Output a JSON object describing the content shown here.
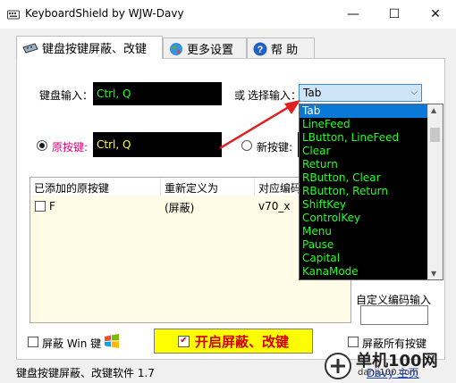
{
  "window": {
    "title": "KeyboardShield by WJW-Davy",
    "minimize_glyph": "—",
    "maximize_glyph": "☐",
    "close_glyph": "✕"
  },
  "tabs": [
    {
      "label": "键盘按键屏蔽、改键",
      "icon": "keyboard-icon",
      "active": true
    },
    {
      "label": "更多设置",
      "icon": "globe-icon",
      "active": false
    },
    {
      "label": "帮 助",
      "icon": "help-icon",
      "active": false
    }
  ],
  "keyboard_input": {
    "label": "键盘输入：",
    "value": "Ctrl, Q"
  },
  "select_input": {
    "or_label": "或",
    "label": "选择输入：",
    "value": "Tab"
  },
  "dropdown": {
    "options": [
      "Tab",
      "LineFeed",
      "LButton, LineFeed",
      "Clear",
      "Return",
      "RButton, Clear",
      "RButton, Return",
      "ShiftKey",
      "ControlKey",
      "Menu",
      "Pause",
      "Capital",
      "KanaMode"
    ],
    "selected": "Tab"
  },
  "original_key": {
    "label": "原按键:",
    "value": "Ctrl, Q",
    "checked": true
  },
  "new_key": {
    "label": "新按键:",
    "checked": false
  },
  "list": {
    "columns": [
      "已添加的原按键",
      "重新定义为",
      "对应编码"
    ],
    "rows": [
      {
        "key": "F",
        "redefine": "(屏蔽)",
        "code": "v70_x",
        "checked": false
      }
    ]
  },
  "custom_code": {
    "label": "自定义编码输入",
    "value": ""
  },
  "block_win": {
    "label": "屏蔽 Win 键",
    "checked": false
  },
  "start_button": {
    "label": "开启屏蔽、改键",
    "checked": true
  },
  "block_all": {
    "label": "屏蔽所有按键",
    "checked": false
  },
  "status": {
    "text": "键盘按键屏蔽、改键软件 1.7"
  },
  "footer_link": {
    "text": "Davy 主页"
  },
  "watermark": {
    "text": "单机100网",
    "sub": "danji100.com"
  },
  "colors": {
    "arrow": "#e02020",
    "black_field_text_green": "#22ff22",
    "black_field_text_yellow": "#ffff33",
    "original_key_label": "#e0007a"
  }
}
